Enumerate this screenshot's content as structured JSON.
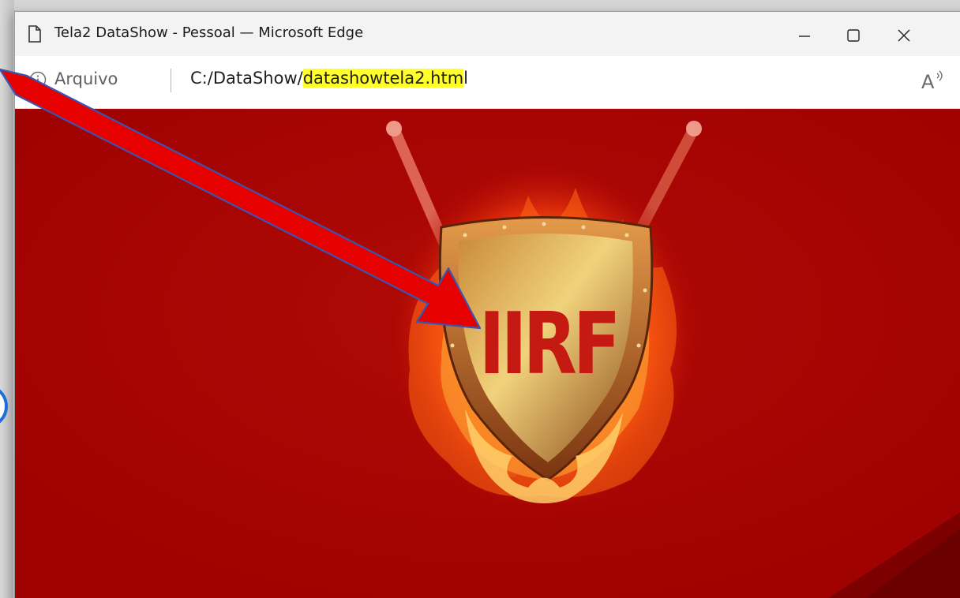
{
  "window": {
    "title": "Tela2 DataShow - Pessoal — Microsoft Edge",
    "controls": {
      "minimize_icon": "minimize-icon",
      "maximize_icon": "maximize-icon",
      "close_icon": "close-icon"
    }
  },
  "addressbar": {
    "scheme_label": "Arquivo",
    "url_prefix": "C:/DataShow/",
    "url_highlight": "datashowtela2.htm",
    "url_suffix": "l",
    "info_icon": "info-icon",
    "read_aloud_icon": "read-aloud-icon"
  },
  "page": {
    "logo_text": "IIRF",
    "background_color": "#a80303"
  },
  "annotation": {
    "arrow_color": "#e60000",
    "highlight_color": "#ffff2a"
  }
}
